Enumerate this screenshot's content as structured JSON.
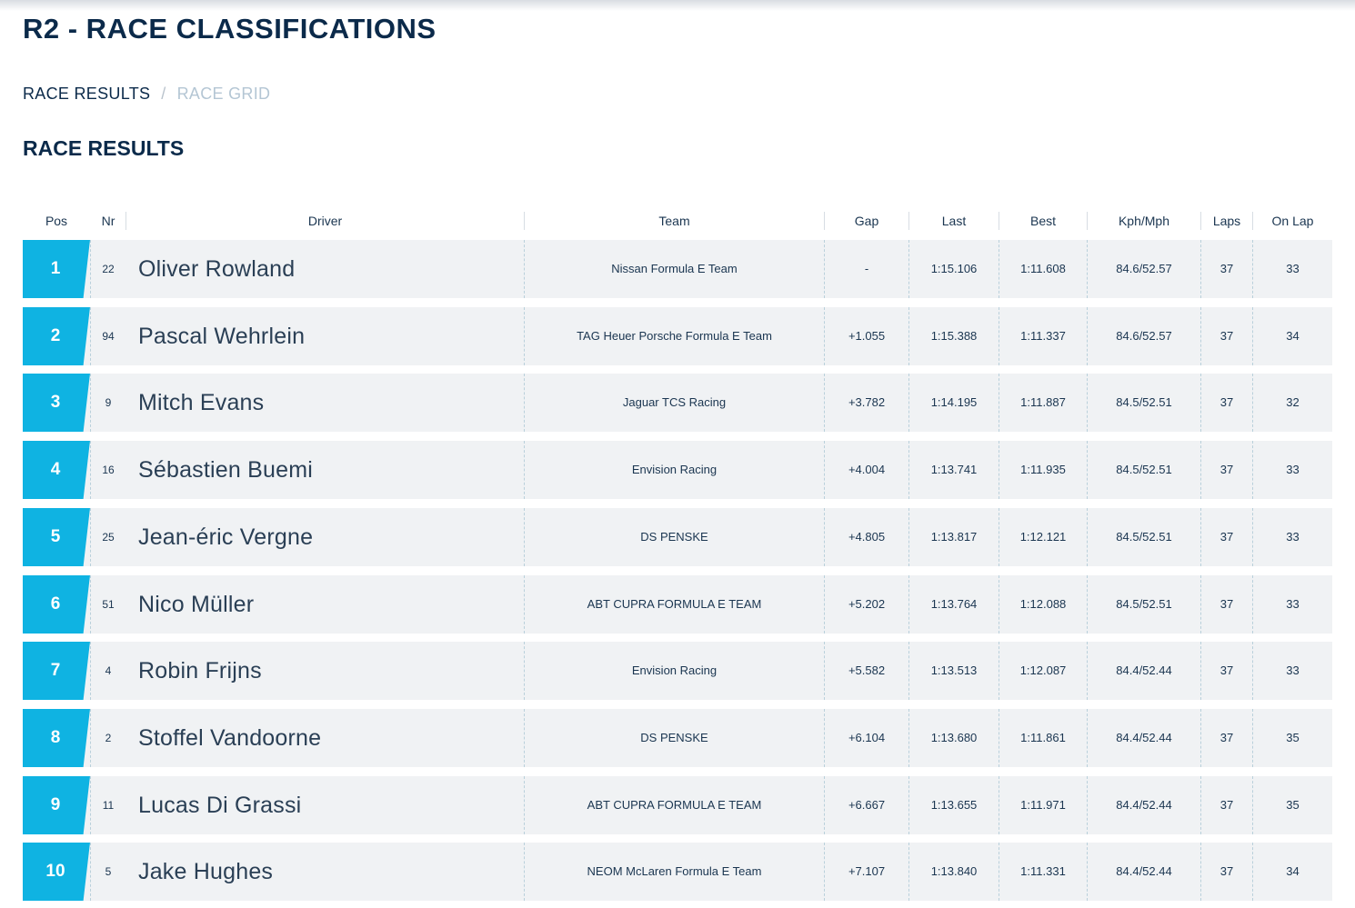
{
  "page": {
    "title": "R2 - RACE CLASSIFICATIONS"
  },
  "tabs": {
    "active": "RACE RESULTS",
    "separator": "/",
    "inactive": "RACE GRID"
  },
  "section": {
    "title": "RACE RESULTS"
  },
  "colors": {
    "accent": "#0fb3e2",
    "navy": "#0b2a4a",
    "row_bg": "#f0f2f4"
  },
  "table": {
    "columns": {
      "pos": "Pos",
      "nr": "Nr",
      "driver": "Driver",
      "team": "Team",
      "gap": "Gap",
      "last": "Last",
      "best": "Best",
      "speed": "Kph/Mph",
      "laps": "Laps",
      "onlap": "On Lap"
    },
    "rows": [
      {
        "pos": "1",
        "nr": "22",
        "driver": "Oliver Rowland",
        "team": "Nissan Formula E Team",
        "gap": "-",
        "last": "1:15.106",
        "best": "1:11.608",
        "speed": "84.6/52.57",
        "laps": "37",
        "onlap": "33"
      },
      {
        "pos": "2",
        "nr": "94",
        "driver": "Pascal Wehrlein",
        "team": "TAG Heuer Porsche Formula E Team",
        "gap": "+1.055",
        "last": "1:15.388",
        "best": "1:11.337",
        "speed": "84.6/52.57",
        "laps": "37",
        "onlap": "34"
      },
      {
        "pos": "3",
        "nr": "9",
        "driver": "Mitch Evans",
        "team": "Jaguar TCS Racing",
        "gap": "+3.782",
        "last": "1:14.195",
        "best": "1:11.887",
        "speed": "84.5/52.51",
        "laps": "37",
        "onlap": "32"
      },
      {
        "pos": "4",
        "nr": "16",
        "driver": "Sébastien Buemi",
        "team": "Envision Racing",
        "gap": "+4.004",
        "last": "1:13.741",
        "best": "1:11.935",
        "speed": "84.5/52.51",
        "laps": "37",
        "onlap": "33"
      },
      {
        "pos": "5",
        "nr": "25",
        "driver": "Jean-éric Vergne",
        "team": "DS PENSKE",
        "gap": "+4.805",
        "last": "1:13.817",
        "best": "1:12.121",
        "speed": "84.5/52.51",
        "laps": "37",
        "onlap": "33"
      },
      {
        "pos": "6",
        "nr": "51",
        "driver": "Nico Müller",
        "team": "ABT CUPRA FORMULA E TEAM",
        "gap": "+5.202",
        "last": "1:13.764",
        "best": "1:12.088",
        "speed": "84.5/52.51",
        "laps": "37",
        "onlap": "33"
      },
      {
        "pos": "7",
        "nr": "4",
        "driver": "Robin Frijns",
        "team": "Envision Racing",
        "gap": "+5.582",
        "last": "1:13.513",
        "best": "1:12.087",
        "speed": "84.4/52.44",
        "laps": "37",
        "onlap": "33"
      },
      {
        "pos": "8",
        "nr": "2",
        "driver": "Stoffel Vandoorne",
        "team": "DS PENSKE",
        "gap": "+6.104",
        "last": "1:13.680",
        "best": "1:11.861",
        "speed": "84.4/52.44",
        "laps": "37",
        "onlap": "35"
      },
      {
        "pos": "9",
        "nr": "11",
        "driver": "Lucas Di Grassi",
        "team": "ABT CUPRA FORMULA E TEAM",
        "gap": "+6.667",
        "last": "1:13.655",
        "best": "1:11.971",
        "speed": "84.4/52.44",
        "laps": "37",
        "onlap": "35"
      },
      {
        "pos": "10",
        "nr": "5",
        "driver": "Jake Hughes",
        "team": "NEOM McLaren Formula E Team",
        "gap": "+7.107",
        "last": "1:13.840",
        "best": "1:11.331",
        "speed": "84.4/52.44",
        "laps": "37",
        "onlap": "34"
      }
    ]
  }
}
